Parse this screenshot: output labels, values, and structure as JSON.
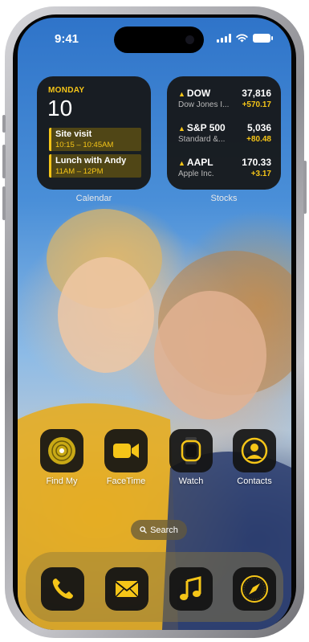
{
  "status_bar": {
    "time": "9:41"
  },
  "widgets": {
    "calendar": {
      "day": "MONDAY",
      "date": "10",
      "events": [
        {
          "title": "Site visit",
          "time": "10:15 – 10:45AM"
        },
        {
          "title": "Lunch with Andy",
          "time": "11AM – 12PM"
        }
      ],
      "label": "Calendar"
    },
    "stocks": {
      "rows": [
        {
          "symbol": "DOW",
          "name": "Dow Jones I...",
          "price": "37,816",
          "change": "+570.17"
        },
        {
          "symbol": "S&P 500",
          "name": "Standard &...",
          "price": "5,036",
          "change": "+80.48"
        },
        {
          "symbol": "AAPL",
          "name": "Apple Inc.",
          "price": "170.33",
          "change": "+3.17"
        }
      ],
      "label": "Stocks"
    }
  },
  "apps": [
    {
      "label": "Find My",
      "icon": "find-my-icon"
    },
    {
      "label": "FaceTime",
      "icon": "facetime-icon"
    },
    {
      "label": "Watch",
      "icon": "watch-icon"
    },
    {
      "label": "Contacts",
      "icon": "contacts-icon"
    }
  ],
  "search": {
    "label": "Search",
    "icon": "search-icon"
  },
  "dock": [
    {
      "icon": "phone-icon"
    },
    {
      "icon": "mail-icon"
    },
    {
      "icon": "music-icon"
    },
    {
      "icon": "safari-icon"
    }
  ],
  "colors": {
    "accent": "#f5c518",
    "widget_bg": "#161616"
  }
}
